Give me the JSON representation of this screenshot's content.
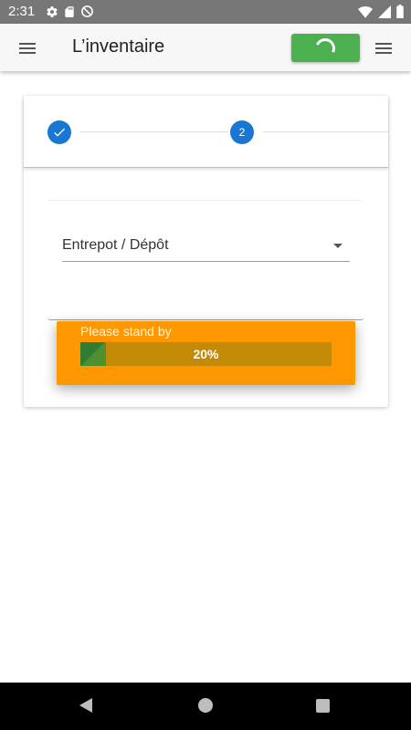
{
  "status_bar": {
    "time": "2:31",
    "left_icons": [
      "gear-icon",
      "sd-card-icon",
      "data-saver-icon"
    ],
    "right_icons": [
      "wifi-icon",
      "signal-icon",
      "battery-icon"
    ]
  },
  "app_bar": {
    "title": "L’inventaire",
    "menu_icon": "hamburger-icon",
    "sync_button_icon": "loading-spinner-icon",
    "sync_button_color": "#4caf50",
    "overflow_menu_icon": "hamburger-icon"
  },
  "stepper": {
    "steps": [
      {
        "label": "",
        "state": "done",
        "icon": "check-icon"
      },
      {
        "label": "2",
        "state": "current"
      }
    ],
    "accent_color": "#1976d2"
  },
  "form": {
    "location_select": {
      "value": "Entrepot / Dépôt"
    }
  },
  "loading_toast": {
    "message": "Please stand by",
    "progress_percent": 20,
    "progress_label": "20%",
    "background_color": "#ff9800"
  },
  "nav_bar": {
    "buttons": [
      "back-icon",
      "home-icon",
      "recents-icon"
    ]
  }
}
